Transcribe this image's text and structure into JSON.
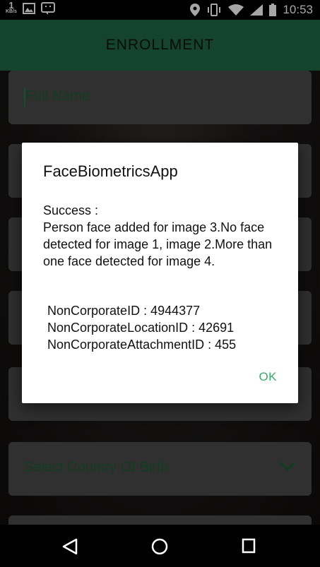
{
  "status_bar": {
    "net_speed_value": "1",
    "net_speed_unit": "KB/s",
    "time": "10:53",
    "icons": [
      "image-icon",
      "notification-icon",
      "location-icon",
      "vibrate-icon",
      "wifi-icon",
      "signal-icon",
      "battery-icon"
    ]
  },
  "app_bar": {
    "title": "ENROLLMENT"
  },
  "form": {
    "full_name_placeholder": "Full Name",
    "country_of_birth_placeholder": "Select Country Of Birth"
  },
  "dialog": {
    "title": "FaceBiometricsApp",
    "status": "Success :",
    "message": "Person face added for image 3.No face detected for image 1, image 2.More than one face detected for image 4.",
    "non_corporate_id": "NonCorporateID : 4944377",
    "non_corporate_location_id": "NonCorporateLocationID : 42691",
    "non_corporate_attachment_id": "NonCorporateAttachmentID : 455",
    "ok_label": "OK"
  },
  "nav_bar": {
    "icons": [
      "back-icon",
      "home-icon",
      "recents-icon"
    ]
  },
  "colors": {
    "app_bar": "#1f6b44",
    "field_bg": "#4b4b4b",
    "field_text": "#1c5c34",
    "ok_accent": "#3aaa6a"
  }
}
